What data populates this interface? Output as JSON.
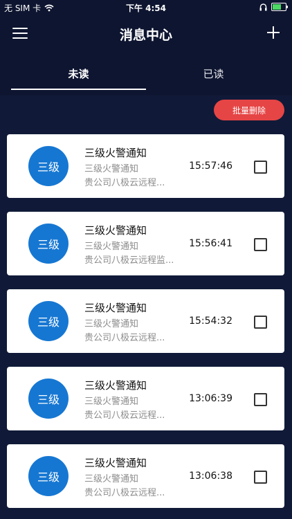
{
  "status_bar": {
    "carrier": "无 SIM 卡",
    "time": "下午 4:54"
  },
  "header": {
    "title": "消息中心"
  },
  "tabs": [
    {
      "label": "未读"
    },
    {
      "label": "已读"
    }
  ],
  "actions": {
    "batch_delete": "批量删除"
  },
  "messages": [
    {
      "avatar": "三级",
      "title": "三级火警通知",
      "subtitle": "三级火警通知",
      "description": "贵公司八极云远程...",
      "time": "15:57:46"
    },
    {
      "avatar": "三级",
      "title": "三级火警通知",
      "subtitle": "三级火警通知",
      "description": "贵公司八极云远程监...",
      "time": "15:56:41"
    },
    {
      "avatar": "三级",
      "title": "三级火警通知",
      "subtitle": "三级火警通知",
      "description": "贵公司八极云远程...",
      "time": "15:54:32"
    },
    {
      "avatar": "三级",
      "title": "三级火警通知",
      "subtitle": "三级火警通知",
      "description": "贵公司八极云远程...",
      "time": "13:06:39"
    },
    {
      "avatar": "三级",
      "title": "三级火警通知",
      "subtitle": "三级火警通知",
      "description": "贵公司八极云远程...",
      "time": "13:06:38"
    }
  ],
  "colors": {
    "background": "#0e1530",
    "avatar": "#1677d2",
    "delete_button": "#e64545"
  }
}
